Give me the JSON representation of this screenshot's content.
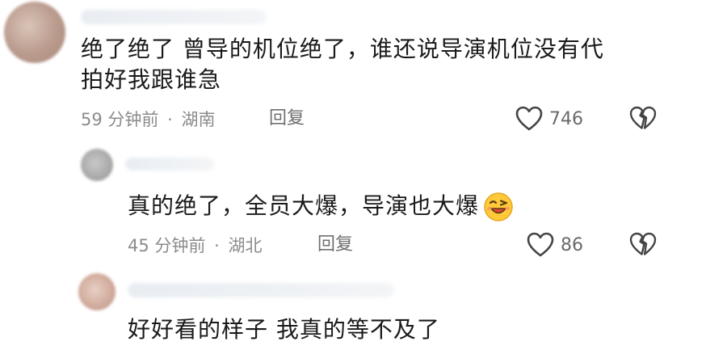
{
  "comments": [
    {
      "text_line1": "绝了绝了 曾导的机位绝了，谁还说导演机位没有代",
      "text_line2": "拍好我跟谁急",
      "time": "59 分钟前",
      "separator": "·",
      "location": "湖南",
      "reply_label": "回复",
      "likes": "746"
    },
    {
      "text": "真的绝了，全员大爆，导演也大爆",
      "emoji": "winking-face-emoji",
      "time": "45 分钟前",
      "separator": "·",
      "location": "湖北",
      "reply_label": "回复",
      "likes": "86"
    },
    {
      "text": "好好看的样子 我真的等不及了"
    }
  ],
  "icons": {
    "like": "heart-outline-icon",
    "dislike": "broken-heart-icon"
  }
}
